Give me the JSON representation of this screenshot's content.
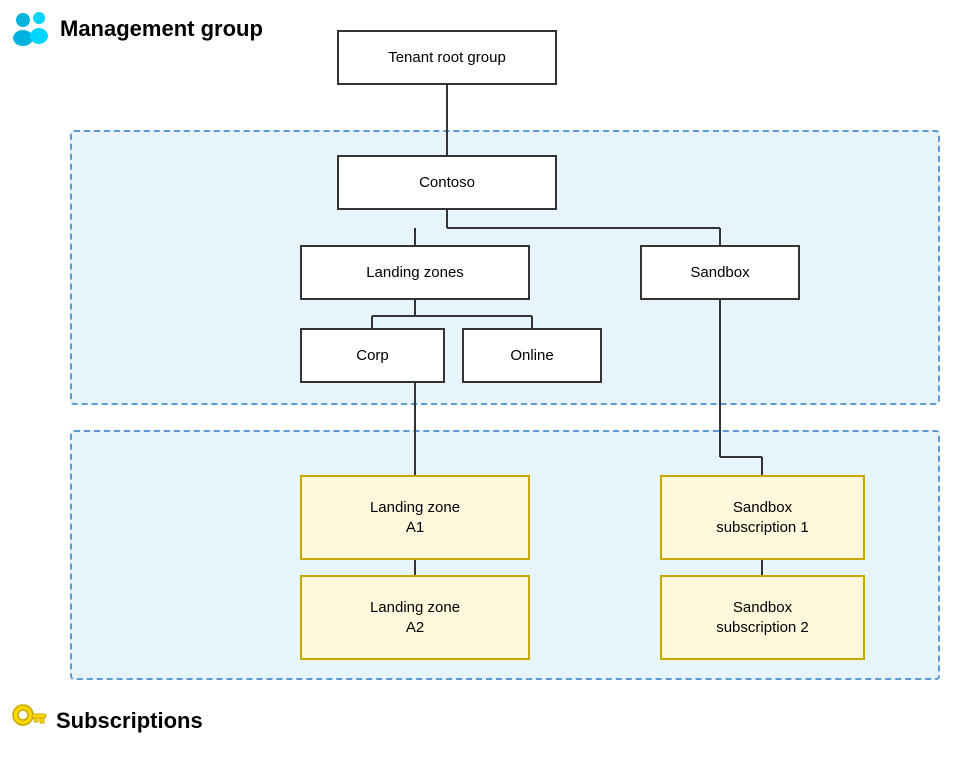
{
  "header": {
    "mgmt_label": "Management group",
    "subs_label": "Subscriptions"
  },
  "nodes": {
    "tenant_root": "Tenant root group",
    "contoso": "Contoso",
    "landing_zones": "Landing zones",
    "sandbox": "Sandbox",
    "corp": "Corp",
    "online": "Online",
    "landing_zone_a1": "Landing zone\nA1",
    "landing_zone_a2": "Landing zone\nA2",
    "sandbox_sub_1": "Sandbox\nsubscription 1",
    "sandbox_sub_2": "Sandbox\nsubscription 2"
  }
}
